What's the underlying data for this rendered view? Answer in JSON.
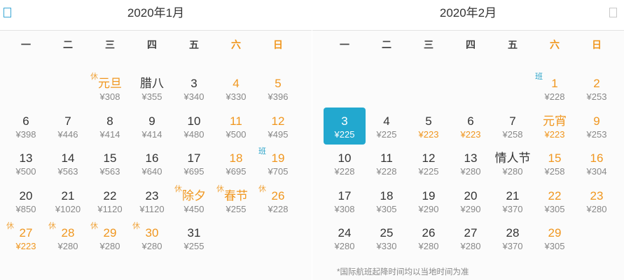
{
  "weekdays": [
    "一",
    "二",
    "三",
    "四",
    "五",
    "六",
    "日"
  ],
  "months": [
    {
      "title": "2020年1月",
      "cells": [
        null,
        null,
        {
          "d": "元旦",
          "p": "¥308",
          "t": "休",
          "hol": true
        },
        {
          "d": "腊八",
          "p": "¥355"
        },
        {
          "d": "3",
          "p": "¥340"
        },
        {
          "d": "4",
          "p": "¥330",
          "we": true
        },
        {
          "d": "5",
          "p": "¥396",
          "we": true
        },
        {
          "d": "6",
          "p": "¥398"
        },
        {
          "d": "7",
          "p": "¥446"
        },
        {
          "d": "8",
          "p": "¥414"
        },
        {
          "d": "9",
          "p": "¥414"
        },
        {
          "d": "10",
          "p": "¥480"
        },
        {
          "d": "11",
          "p": "¥500",
          "we": true
        },
        {
          "d": "12",
          "p": "¥495",
          "we": true
        },
        {
          "d": "13",
          "p": "¥500"
        },
        {
          "d": "14",
          "p": "¥563"
        },
        {
          "d": "15",
          "p": "¥563"
        },
        {
          "d": "16",
          "p": "¥640"
        },
        {
          "d": "17",
          "p": "¥695"
        },
        {
          "d": "18",
          "p": "¥695",
          "we": true
        },
        {
          "d": "19",
          "p": "¥705",
          "we": true,
          "t": "班"
        },
        {
          "d": "20",
          "p": "¥850"
        },
        {
          "d": "21",
          "p": "¥1020"
        },
        {
          "d": "22",
          "p": "¥1120"
        },
        {
          "d": "23",
          "p": "¥1120"
        },
        {
          "d": "除夕",
          "p": "¥450",
          "t": "休",
          "hol": true
        },
        {
          "d": "春节",
          "p": "¥255",
          "t": "休",
          "hol": true
        },
        {
          "d": "26",
          "p": "¥228",
          "t": "休",
          "hol": true
        },
        {
          "d": "27",
          "p": "¥223",
          "t": "休",
          "hol": true,
          "low": true
        },
        {
          "d": "28",
          "p": "¥280",
          "t": "休",
          "hol": true
        },
        {
          "d": "29",
          "p": "¥280",
          "t": "休",
          "hol": true
        },
        {
          "d": "30",
          "p": "¥280",
          "t": "休",
          "hol": true
        },
        {
          "d": "31",
          "p": "¥255"
        }
      ]
    },
    {
      "title": "2020年2月",
      "cells": [
        null,
        null,
        null,
        null,
        null,
        {
          "d": "1",
          "p": "¥228",
          "we": true,
          "t": "班"
        },
        {
          "d": "2",
          "p": "¥253",
          "we": true
        },
        {
          "d": "3",
          "p": "¥225",
          "sel": true
        },
        {
          "d": "4",
          "p": "¥225"
        },
        {
          "d": "5",
          "p": "¥223",
          "low": true
        },
        {
          "d": "6",
          "p": "¥223",
          "low": true
        },
        {
          "d": "7",
          "p": "¥258"
        },
        {
          "d": "元宵",
          "p": "¥223",
          "we": true,
          "low": true
        },
        {
          "d": "9",
          "p": "¥253",
          "we": true
        },
        {
          "d": "10",
          "p": "¥228"
        },
        {
          "d": "11",
          "p": "¥228"
        },
        {
          "d": "12",
          "p": "¥225"
        },
        {
          "d": "13",
          "p": "¥280"
        },
        {
          "d": "情人节",
          "p": "¥280"
        },
        {
          "d": "15",
          "p": "¥258",
          "we": true
        },
        {
          "d": "16",
          "p": "¥304",
          "we": true
        },
        {
          "d": "17",
          "p": "¥308"
        },
        {
          "d": "18",
          "p": "¥305"
        },
        {
          "d": "19",
          "p": "¥290"
        },
        {
          "d": "20",
          "p": "¥290"
        },
        {
          "d": "21",
          "p": "¥370"
        },
        {
          "d": "22",
          "p": "¥305",
          "we": true
        },
        {
          "d": "23",
          "p": "¥280",
          "we": true
        },
        {
          "d": "24",
          "p": "¥280"
        },
        {
          "d": "25",
          "p": "¥330"
        },
        {
          "d": "26",
          "p": "¥280"
        },
        {
          "d": "27",
          "p": "¥280"
        },
        {
          "d": "28",
          "p": "¥370"
        },
        {
          "d": "29",
          "p": "¥305",
          "we": true
        }
      ]
    }
  ],
  "footnote": "*国际航班起降时间均以当地时间为准"
}
